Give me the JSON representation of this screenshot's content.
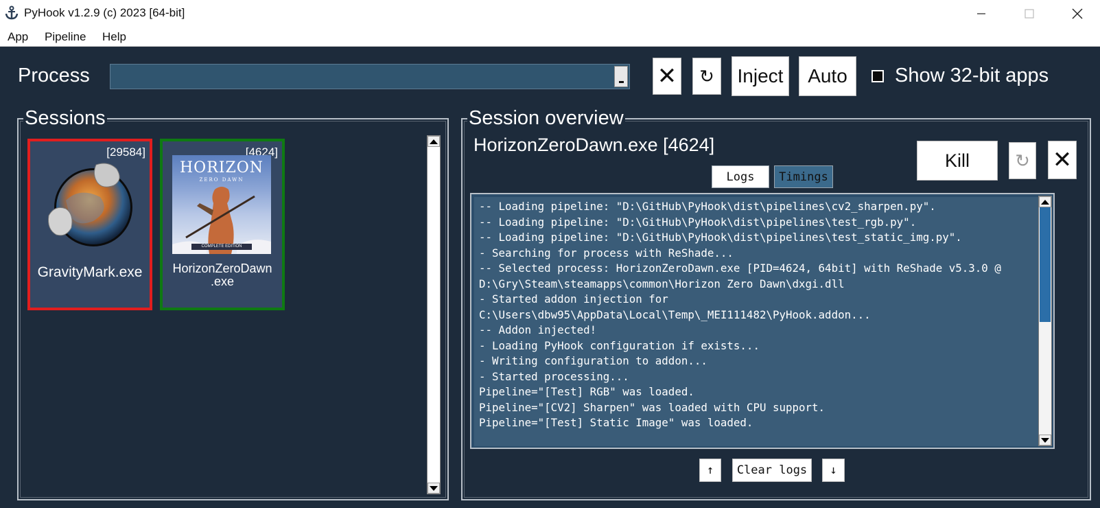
{
  "window": {
    "title": "PyHook v1.2.9 (c) 2023 [64-bit]",
    "app_icon": "anchor-icon",
    "controls": {
      "minimize": "minimize-icon",
      "maximize": "maximize-icon",
      "close": "close-icon"
    }
  },
  "menu": [
    "App",
    "Pipeline",
    "Help"
  ],
  "process": {
    "label": "Process",
    "value": "",
    "buttons": {
      "clear": "✕",
      "refresh": "↻",
      "inject": "Inject",
      "auto": "Auto"
    },
    "show32_label": "Show 32-bit apps",
    "show32_checked": false
  },
  "sessions": {
    "title": "Sessions",
    "items": [
      {
        "pid": "[29584]",
        "name": "GravityMark.exe",
        "border_color": "#e11e1e",
        "icon": "gravitymark-icon"
      },
      {
        "pid": "[4624]",
        "name_line1": "HorizonZeroDawn",
        "name_line2": ".exe",
        "border_color": "#0f7a12",
        "icon": "horizon-zero-dawn-cover",
        "cover_title": "HORIZON",
        "cover_subtitle": "ZERO DAWN",
        "cover_edition": "COMPLETE EDITION"
      }
    ]
  },
  "overview": {
    "title": "Session overview",
    "session_name": "HorizonZeroDawn.exe [4624]",
    "buttons": {
      "kill": "Kill",
      "refresh": "↻",
      "close": "✕"
    },
    "tabs": [
      "Logs",
      "Timings"
    ],
    "log_lines": [
      "-- Loading pipeline: \"D:\\GitHub\\PyHook\\dist\\pipelines\\cv2_sharpen.py\".",
      "-- Loading pipeline: \"D:\\GitHub\\PyHook\\dist\\pipelines\\test_rgb.py\".",
      "-- Loading pipeline: \"D:\\GitHub\\PyHook\\dist\\pipelines\\test_static_img.py\".",
      "- Searching for process with ReShade...",
      "-- Selected process: HorizonZeroDawn.exe [PID=4624, 64bit] with ReShade v5.3.0 @",
      "D:\\Gry\\Steam\\steamapps\\common\\Horizon Zero Dawn\\dxgi.dll",
      "- Started addon injection for",
      "C:\\Users\\dbw95\\AppData\\Local\\Temp\\_MEI111482\\PyHook.addon...",
      "-- Addon injected!",
      "- Loading PyHook configuration if exists...",
      "- Writing configuration to addon...",
      "- Started processing...",
      "Pipeline=\"[Test] RGB\" was loaded.",
      "Pipeline=\"[CV2] Sharpen\" was loaded with CPU support.",
      "Pipeline=\"[Test] Static Image\" was loaded."
    ],
    "bottom": {
      "up": "↑",
      "clear": "Clear logs",
      "down": "↓"
    }
  }
}
